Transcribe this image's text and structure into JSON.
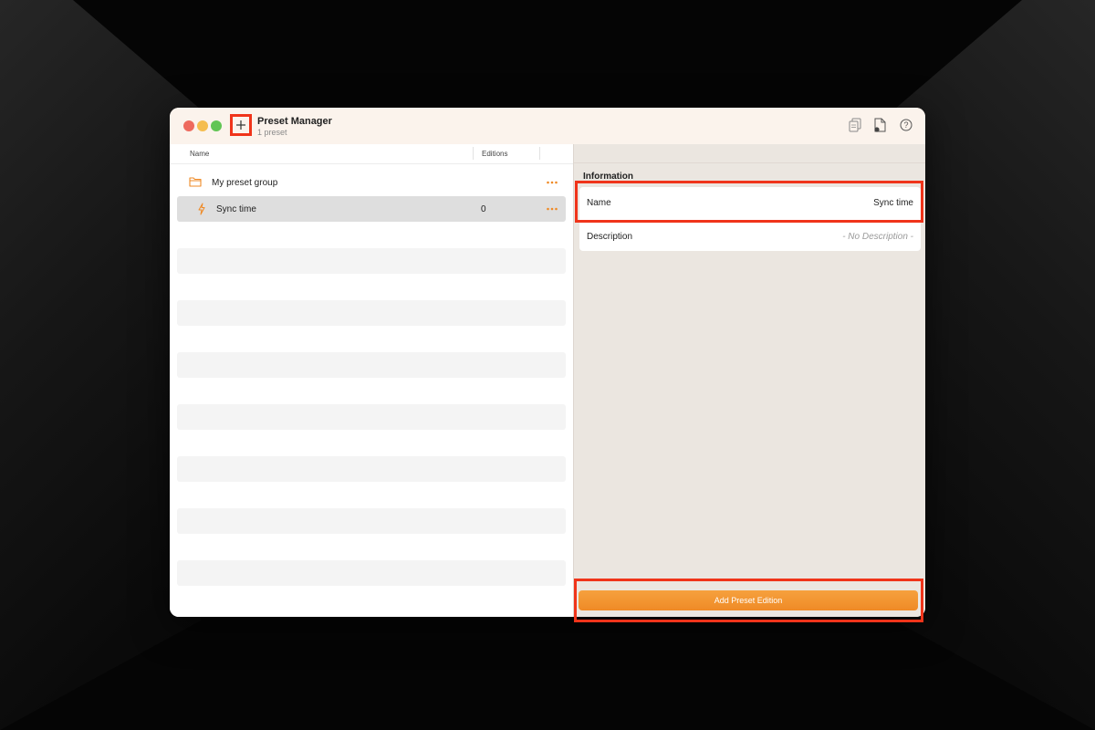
{
  "window": {
    "title": "Preset Manager",
    "subtitle": "1 preset"
  },
  "toolbar": {
    "add_icon": "plus-icon",
    "icons": [
      "copy-icon",
      "export-icon",
      "help-icon"
    ]
  },
  "list": {
    "columns": {
      "name": "Name",
      "editions": "Editions"
    },
    "rows": [
      {
        "icon": "folder-icon",
        "label": "My preset group",
        "count": ""
      },
      {
        "icon": "lightning-icon",
        "label": "Sync time",
        "count": "0"
      }
    ]
  },
  "information": {
    "title": "Information",
    "name_label": "Name",
    "name_value": "Sync time",
    "description_label": "Description",
    "description_value": "- No Description -"
  },
  "actions": {
    "add_edition_label": "Add Preset Edition"
  },
  "colors": {
    "accent": "#EF8A26",
    "highlight": "#F0341A"
  }
}
